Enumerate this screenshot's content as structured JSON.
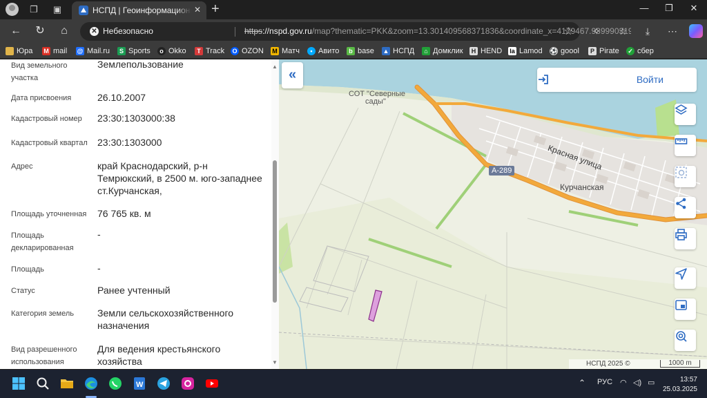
{
  "browser": {
    "tab_title": "НСПД | Геоинформационный портал",
    "security_label": "Небезопасно",
    "url_proto": "https",
    "url_host": "://nspd.gov.ru",
    "url_rest": "/map?thematic=PKK&zoom=13.301409568371836&coordinate_x=4179467.9399903193&co..."
  },
  "bookmarks": [
    {
      "label": "Юра",
      "icon": "folder-icon",
      "color": "#e0b44a"
    },
    {
      "label": "mail",
      "icon": "gmail-icon",
      "color": "#d93025"
    },
    {
      "label": "Mail.ru",
      "icon": "mailru-icon",
      "color": "#1f6fff"
    },
    {
      "label": "Sports",
      "icon": "sports-icon",
      "color": "#1b9c53"
    },
    {
      "label": "Okko",
      "icon": "okko-icon",
      "color": "#222222"
    },
    {
      "label": "Track",
      "icon": "track-icon",
      "color": "#d43a3a"
    },
    {
      "label": "OZON",
      "icon": "ozon-icon",
      "color": "#005bff"
    },
    {
      "label": "Матч",
      "icon": "match-icon",
      "color": "#f2b600"
    },
    {
      "label": "Авито",
      "icon": "avito-icon",
      "color": "#00aaff"
    },
    {
      "label": "base",
      "icon": "base-icon",
      "color": "#5ab946"
    },
    {
      "label": "НСПД",
      "icon": "nspd-icon",
      "color": "#2e6cc3"
    },
    {
      "label": "Домклик",
      "icon": "domclick-icon",
      "color": "#21a038"
    },
    {
      "label": "HEND",
      "icon": "hend-icon",
      "color": "#dddddd"
    },
    {
      "label": "Lamod",
      "icon": "lamoda-icon",
      "color": "#222222"
    },
    {
      "label": "goool",
      "icon": "goool-icon",
      "color": "#cccccc"
    },
    {
      "label": "Pirate",
      "icon": "pirate-icon",
      "color": "#dddddd"
    },
    {
      "label": "сбер",
      "icon": "sber-icon",
      "color": "#21a038"
    }
  ],
  "panel": {
    "rows": [
      {
        "label": "Вид земельного участка",
        "value": "Землепользование"
      },
      {
        "label": "Дата присвоения",
        "value": "26.10.2007"
      },
      {
        "label": "Кадастровый номер",
        "value": "23:30:1303000:38"
      },
      {
        "label": "Кадастровый квартал",
        "value": "23:30:1303000"
      },
      {
        "label": "Адрес",
        "value": "край Краснодарский, р-н Темрюкский, в 2500 м. юго-западнее ст.Курчанская,"
      },
      {
        "label": "Площадь уточненная",
        "value": "76 765 кв. м"
      },
      {
        "label": "Площадь декларированная",
        "value": "-"
      },
      {
        "label": "Площадь",
        "value": "-"
      },
      {
        "label": "Статус",
        "value": "Ранее учтенный"
      },
      {
        "label": "Категория земель",
        "value": "Земли сельскохозяйственного назначения"
      },
      {
        "label": "Вид разрешенного использования",
        "value": "Для ведения крестьянского хозяйства"
      }
    ]
  },
  "map": {
    "login_label": "Войти",
    "labels": {
      "sot_line1": "СОТ \"Северные",
      "sot_line2": "сады\"",
      "street": "Красная улица",
      "road": "А-289",
      "village": "Курчанская"
    },
    "attribution": "НСПД 2025 ©",
    "scale": "1000 m",
    "colors": {
      "water": "#aad3df",
      "road": "#f2a93b",
      "parcel": "#dda0dd"
    }
  },
  "taskbar": {
    "lang": "РУС",
    "time": "13:57",
    "date": "25.03.2025"
  }
}
